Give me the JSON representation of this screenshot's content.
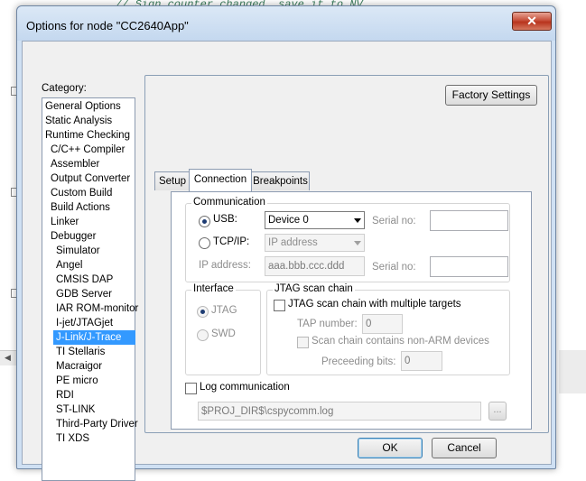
{
  "editor": {
    "code_comment": "// Sign counter changed, save it to NV"
  },
  "dialog": {
    "title": "Options for node \"CC2640App\"",
    "close_glyph": "✕",
    "category_label": "Category:",
    "categories": [
      {
        "label": "General Options",
        "indent": 0
      },
      {
        "label": "Static Analysis",
        "indent": 0
      },
      {
        "label": "Runtime Checking",
        "indent": 0
      },
      {
        "label": "C/C++ Compiler",
        "indent": 1
      },
      {
        "label": "Assembler",
        "indent": 1
      },
      {
        "label": "Output Converter",
        "indent": 1
      },
      {
        "label": "Custom Build",
        "indent": 1
      },
      {
        "label": "Build Actions",
        "indent": 1
      },
      {
        "label": "Linker",
        "indent": 1
      },
      {
        "label": "Debugger",
        "indent": 1
      },
      {
        "label": "Simulator",
        "indent": 2
      },
      {
        "label": "Angel",
        "indent": 2
      },
      {
        "label": "CMSIS DAP",
        "indent": 2
      },
      {
        "label": "GDB Server",
        "indent": 2
      },
      {
        "label": "IAR ROM-monitor",
        "indent": 2
      },
      {
        "label": "I-jet/JTAGjet",
        "indent": 2
      },
      {
        "label": "J-Link/J-Trace",
        "indent": 2,
        "selected": true
      },
      {
        "label": "TI Stellaris",
        "indent": 2
      },
      {
        "label": "Macraigor",
        "indent": 2
      },
      {
        "label": "PE micro",
        "indent": 2
      },
      {
        "label": "RDI",
        "indent": 2
      },
      {
        "label": "ST-LINK",
        "indent": 2
      },
      {
        "label": "Third-Party Driver",
        "indent": 2
      },
      {
        "label": "TI XDS",
        "indent": 2
      }
    ],
    "factory_settings": "Factory Settings",
    "tabs": [
      "Setup",
      "Connection",
      "Breakpoints"
    ],
    "active_tab": "Connection",
    "communication": {
      "title": "Communication",
      "usb_label": "USB:",
      "usb_device": "Device 0",
      "serial_label": "Serial no:",
      "serial_value": "",
      "tcpip_label": "TCP/IP:",
      "tcpip_placeholder": "IP address",
      "ip_address_label": "IP address:",
      "ip_address_value": "aaa.bbb.ccc.ddd",
      "serial2_label": "Serial no:",
      "serial2_value": ""
    },
    "interface": {
      "title": "Interface",
      "jtag": "JTAG",
      "swd": "SWD"
    },
    "jtag_chain": {
      "title": "JTAG scan chain",
      "multiple_targets": "JTAG scan chain with multiple targets",
      "tap_label": "TAP number:",
      "tap_value": "0",
      "non_arm": "Scan chain contains non-ARM devices",
      "preceding_label": "Preceeding bits:",
      "preceding_value": "0"
    },
    "log": {
      "label": "Log communication",
      "path": "$PROJ_DIR$\\cspycomm.log",
      "browse": "..."
    },
    "ok": "OK",
    "cancel": "Cancel"
  }
}
